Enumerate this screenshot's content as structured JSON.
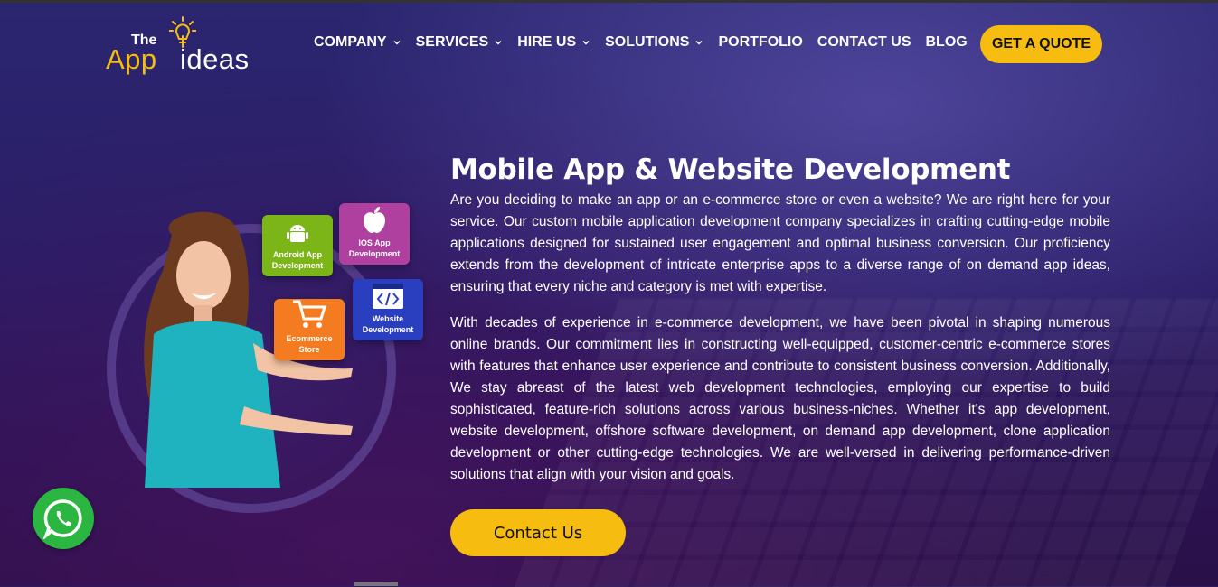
{
  "brand": {
    "logo_the": "The",
    "logo_app": "App",
    "logo_ideas": "ideas",
    "accent_color": "#f6bd10"
  },
  "nav": {
    "items": [
      {
        "label": "COMPANY",
        "has_dropdown": true
      },
      {
        "label": "SERVICES",
        "has_dropdown": true
      },
      {
        "label": "HIRE US",
        "has_dropdown": true
      },
      {
        "label": "SOLUTIONS",
        "has_dropdown": true
      },
      {
        "label": "PORTFOLIO",
        "has_dropdown": false
      },
      {
        "label": "CONTACT US",
        "has_dropdown": false
      },
      {
        "label": "BLOG",
        "has_dropdown": false
      }
    ],
    "cta_label": "GET A QUOTE"
  },
  "hero_cards": {
    "android": "Android App Development",
    "android_l1": "Android App",
    "android_l2": "Development",
    "ios_l1": "IOS App",
    "ios_l2": "Development",
    "ecom_l1": "Ecommerce",
    "ecom_l2": "Store",
    "web_l1": "Website",
    "web_l2": "Development"
  },
  "main": {
    "title": "Mobile App & Website Development",
    "paragraph_1": "Are you deciding to make an app or an e-commerce store or even a website? We are right here for your service. Our custom mobile application development company specializes in crafting cutting-edge mobile applications designed for sustained user engagement and optimal business conversion. Our proficiency extends from the development of intricate enterprise apps to a diverse range of on demand app ideas, ensuring that every niche and category is met with expertise.",
    "paragraph_2": "With decades of experience in e-commerce development, we have been pivotal in shaping numerous online brands. Our commitment lies in constructing well-equipped, customer-centric e-commerce stores with features that enhance user experience and contribute to consistent business conversion. Additionally, We stay abreast of the latest web development technologies, employing our expertise to build sophisticated, feature-rich solutions across various business-niches. Whether it's app development, website development, offshore software development, on demand app development, clone application development or other cutting-edge technologies. We are well-versed in delivering performance-driven solutions that align with your vision and goals.",
    "contact_button": "Contact Us"
  },
  "icons": [
    "lightbulb-icon",
    "chevron-down-icon",
    "android-icon",
    "apple-icon",
    "cart-icon",
    "code-icon",
    "whatsapp-icon"
  ]
}
